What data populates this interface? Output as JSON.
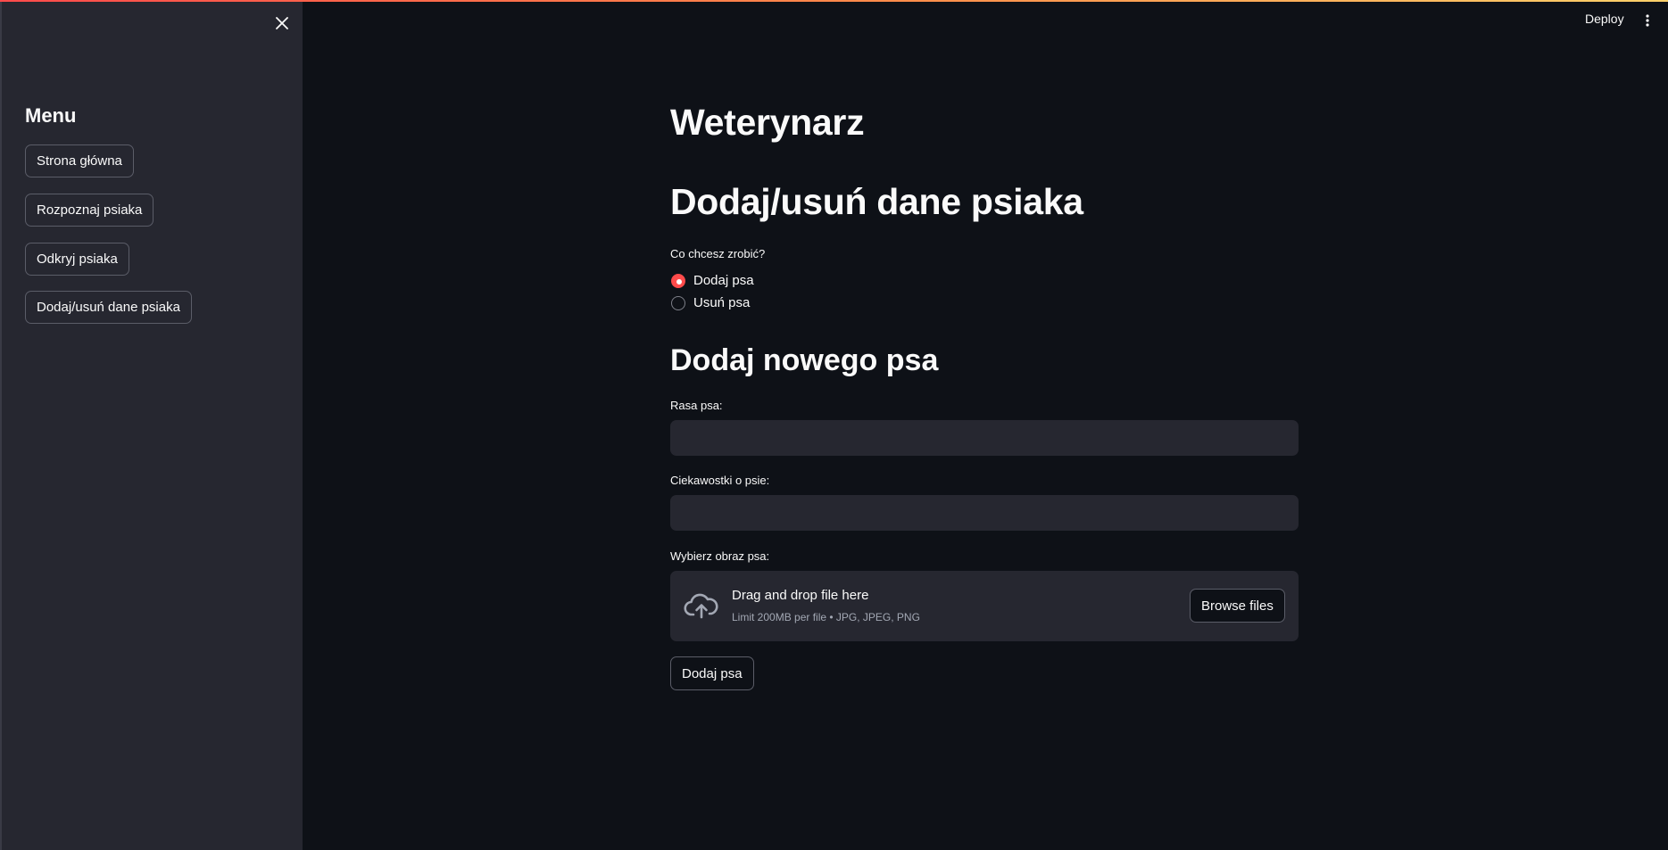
{
  "header": {
    "deploy_label": "Deploy",
    "menu_icon": "kebab-menu-icon"
  },
  "sidebar": {
    "close_icon": "close-icon",
    "title": "Menu",
    "items": [
      {
        "label": "Strona główna"
      },
      {
        "label": "Rozpoznaj psiaka"
      },
      {
        "label": "Odkryj psiaka"
      },
      {
        "label": "Dodaj/usuń dane psiaka"
      }
    ]
  },
  "main": {
    "title": "Weterynarz",
    "subtitle": "Dodaj/usuń dane psiaka",
    "action_question": "Co chcesz zrobić?",
    "action_options": [
      {
        "label": "Dodaj psa",
        "selected": true
      },
      {
        "label": "Usuń psa",
        "selected": false
      }
    ],
    "form_title": "Dodaj nowego psa",
    "breed_label": "Rasa psa:",
    "breed_value": "",
    "facts_label": "Ciekawostki o psie:",
    "facts_value": "",
    "image_label": "Wybierz obraz psa:",
    "dropzone": {
      "icon": "cloud-upload-icon",
      "title": "Drag and drop file here",
      "limit": "Limit 200MB per file • JPG, JPEG, PNG",
      "browse_label": "Browse files"
    },
    "submit_label": "Dodaj psa"
  },
  "colors": {
    "background": "#0e1117",
    "sidebar": "#262730",
    "accent": "#ff4b4b",
    "text": "#fafafa"
  }
}
